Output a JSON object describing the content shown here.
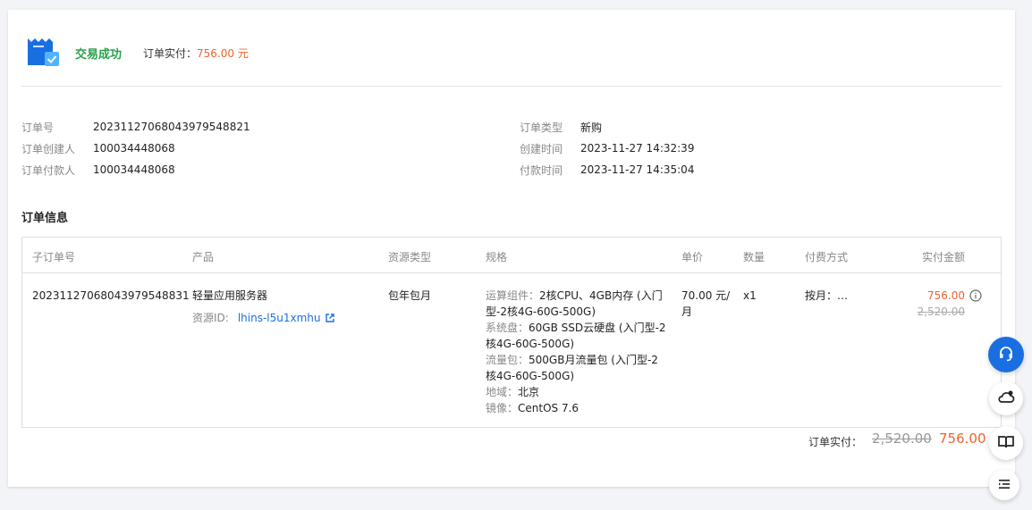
{
  "header": {
    "status_title": "交易成功",
    "paid_label": "订单实付：",
    "paid_amount": "756.00 元"
  },
  "meta": {
    "left": [
      {
        "label": "订单号",
        "value": "20231127068043979548821"
      },
      {
        "label": "订单创建人",
        "value": "100034448068"
      },
      {
        "label": "订单付款人",
        "value": "100034448068"
      }
    ],
    "right": [
      {
        "label": "订单类型",
        "value": "新购"
      },
      {
        "label": "创建时间",
        "value": "2023-11-27 14:32:39"
      },
      {
        "label": "付款时间",
        "value": "2023-11-27 14:35:04"
      }
    ]
  },
  "section_title": "订单信息",
  "table": {
    "headers": [
      "子订单号",
      "产品",
      "资源类型",
      "规格",
      "单价",
      "数量",
      "付费方式",
      "实付金额"
    ],
    "row": {
      "sub_order_no": "20231127068043979548831",
      "product": "轻量应用服务器",
      "resource_id_label": "资源ID:",
      "resource_id": "lhins-l5u1xmhu",
      "resource_type": "包年包月",
      "specs": [
        {
          "key": "运算组件：",
          "value": "2核CPU、4GB内存 (入门",
          "cont": "型-2核4G-60G-500G)"
        },
        {
          "key": "系统盘：",
          "value": "60GB SSD云硬盘 (入门型-2",
          "cont": "核4G-60G-500G)"
        },
        {
          "key": "流量包：",
          "value": "500GB月流量包 (入门型-2",
          "cont": "核4G-60G-500G)"
        },
        {
          "key": "地域：",
          "value": "北京",
          "cont": ""
        },
        {
          "key": "镜像：",
          "value": "CentOS 7.6",
          "cont": ""
        }
      ],
      "unit_price_line1": "70.00 元/",
      "unit_price_line2": "月",
      "quantity": "x1",
      "pay_mode": "按月：…",
      "paid_amount": "756.00",
      "original_amount": "2,520.00"
    }
  },
  "footer": {
    "label": "订单实付：",
    "original": "2,520.00",
    "final": "756.00"
  },
  "float_buttons": [
    "headset-icon",
    "cloud-icon",
    "book-icon",
    "list-icon"
  ],
  "colors": {
    "success": "#29a049",
    "accent": "#f0632a",
    "link": "#1a6fe0"
  }
}
